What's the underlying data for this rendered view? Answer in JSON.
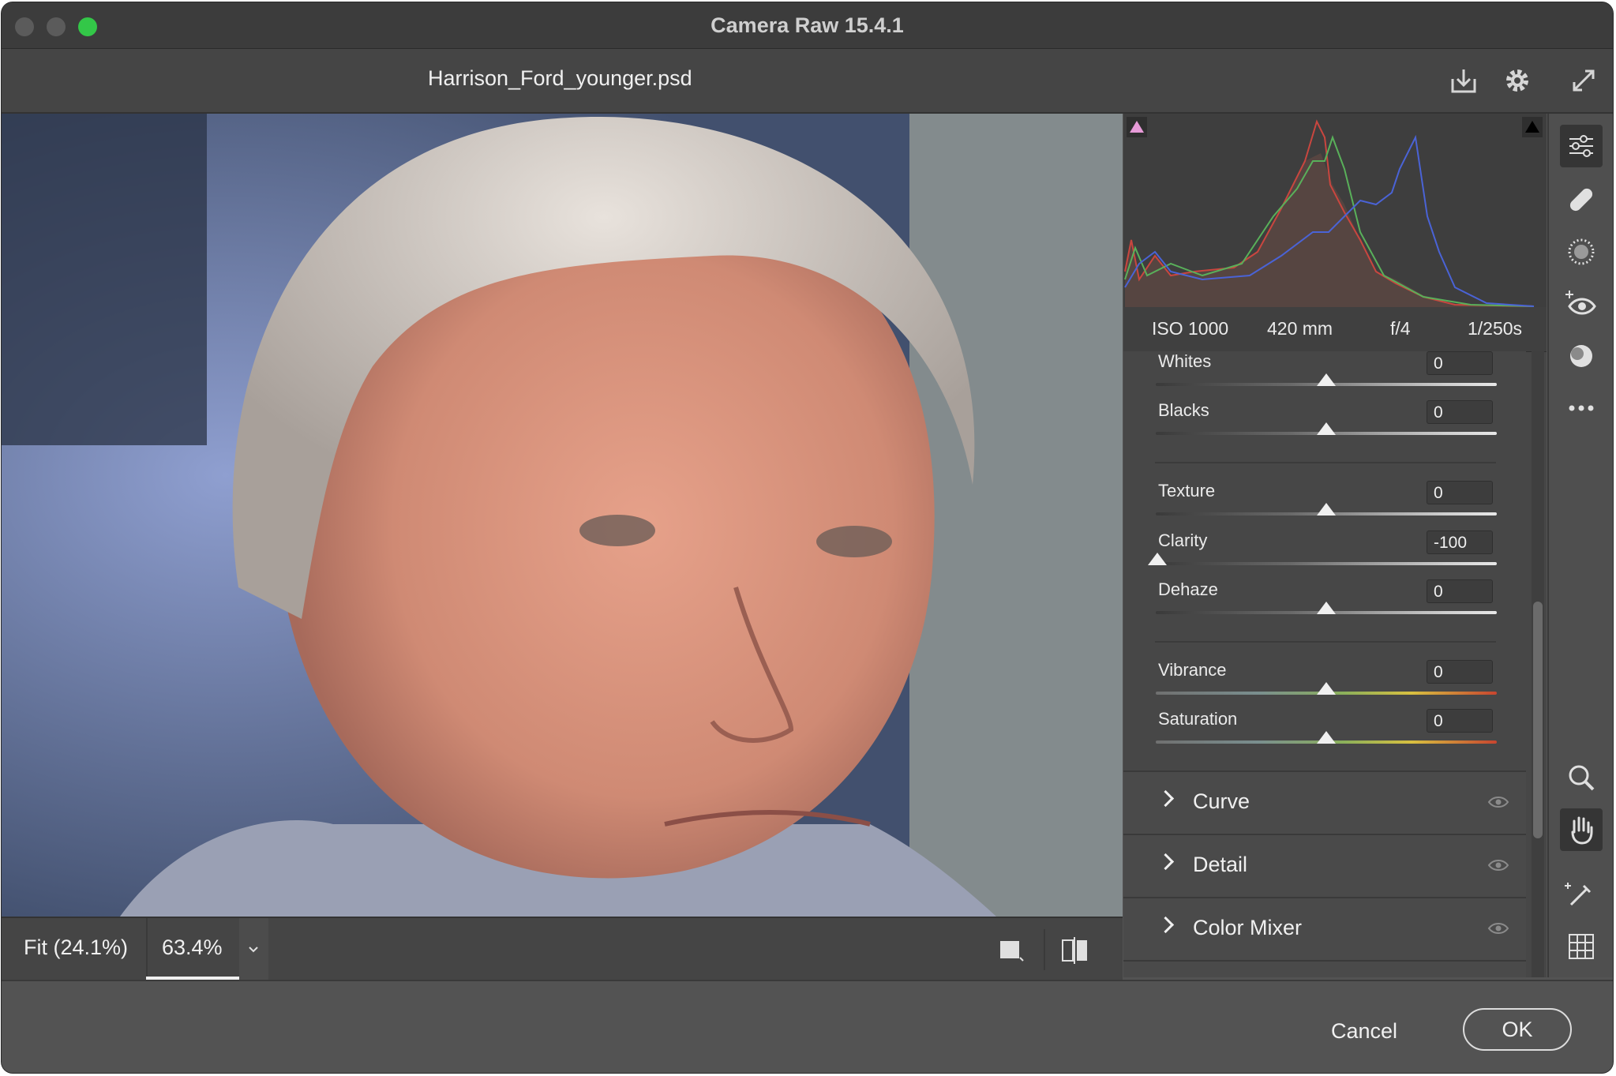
{
  "window": {
    "title": "Camera Raw 15.4.1",
    "traffic_lights": {
      "close": "#5b5b5b",
      "minimize": "#5b5b5b",
      "zoom": "#33c748"
    }
  },
  "header": {
    "filename": "Harrison_Ford_younger.psd",
    "icons": [
      "save-icon",
      "gear-icon",
      "fullscreen-icon"
    ]
  },
  "histogram": {
    "shadow_clip_color": "#e79bd8",
    "highlight_clip_color": "#000000",
    "exif": {
      "iso": "ISO 1000",
      "focal": "420 mm",
      "aperture": "f/4",
      "shutter": "1/250s"
    }
  },
  "sliders": [
    {
      "label": "Whites",
      "value": "0",
      "level": 0.5,
      "track": "gray"
    },
    {
      "label": "Blacks",
      "value": "0",
      "level": 0.5,
      "track": "gray"
    },
    {
      "label": "Texture",
      "value": "0",
      "level": 0.5,
      "track": "gray"
    },
    {
      "label": "Clarity",
      "value": "-100",
      "level": 0.0,
      "track": "gray"
    },
    {
      "label": "Dehaze",
      "value": "0",
      "level": 0.5,
      "track": "gray"
    },
    {
      "label": "Vibrance",
      "value": "0",
      "level": 0.5,
      "track": "color"
    },
    {
      "label": "Saturation",
      "value": "0",
      "level": 0.5,
      "track": "color"
    }
  ],
  "sections": [
    {
      "label": "Curve"
    },
    {
      "label": "Detail"
    },
    {
      "label": "Color Mixer"
    }
  ],
  "viewer": {
    "zoom_fit": "Fit (24.1%)",
    "zoom_value": "63.4%"
  },
  "tools": [
    "edit-icon",
    "healing-brush-icon",
    "masking-icon",
    "red-eye-icon",
    "presets-icon",
    "more-icon",
    "zoom-icon",
    "hand-icon",
    "color-sampler-icon",
    "grid-overlay-icon"
  ],
  "footer": {
    "cancel": "Cancel",
    "ok": "OK"
  }
}
